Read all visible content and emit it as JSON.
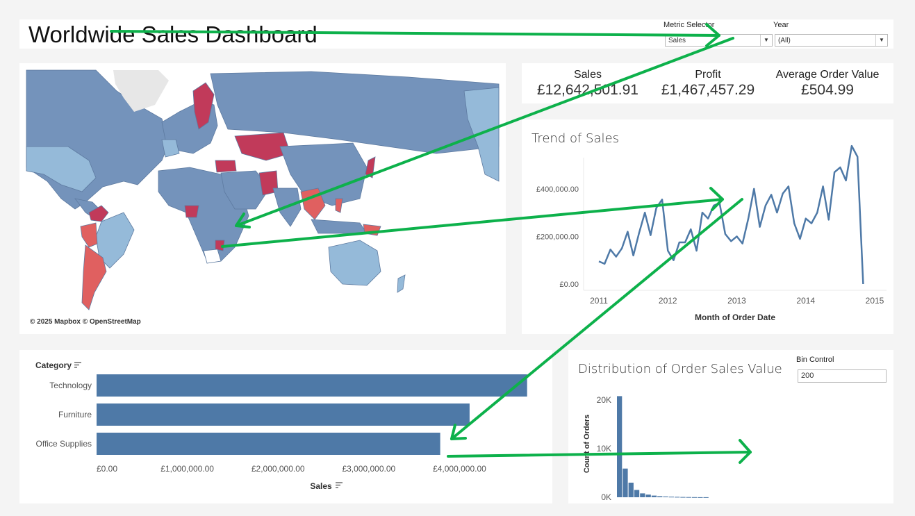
{
  "header": {
    "title": "Worldwide Sales Dashboard",
    "metric_selector": {
      "label": "Metric Selector",
      "value": "Sales"
    },
    "year": {
      "label": "Year",
      "value": "(All)"
    }
  },
  "map": {
    "credit": "© 2025 Mapbox © OpenStreetMap",
    "colors": {
      "ocean": "#ffffff",
      "land_base": "#7493bb",
      "land_light": "#95bad9",
      "land_low": "#c13a5a",
      "land_mid": "#e06060"
    }
  },
  "kpis": [
    {
      "label": "Sales",
      "value": "£12,642,501.91"
    },
    {
      "label": "Profit",
      "value": "£1,467,457.29"
    },
    {
      "label": "Average Order Value",
      "value": "£504.99"
    }
  ],
  "trend": {
    "title": "Trend of Sales",
    "xlabel": "Month of Order Date",
    "ytick_labels": [
      "£400,000.00",
      "£200,000.00",
      "£0.00"
    ],
    "xtick_labels": [
      "2011",
      "2012",
      "2013",
      "2014",
      "2015"
    ]
  },
  "category": {
    "header": "Category",
    "xlabel": "Sales",
    "xtick_labels": [
      "£0.00",
      "£1,000,000.00",
      "£2,000,000.00",
      "£3,000,000.00",
      "£4,000,000.00"
    ]
  },
  "distribution": {
    "title": "Distribution of Order Sales Value",
    "bin_control_label": "Bin Control",
    "bin_value": "200",
    "ylabel": "Count of Orders",
    "ytick_labels": [
      "20K",
      "10K",
      "0K"
    ]
  },
  "chart_data": [
    {
      "type": "line",
      "title": "Trend of Sales",
      "xlabel": "Month of Order Date",
      "ylabel": "",
      "xlim": [
        2011,
        2015
      ],
      "ylim": [
        0,
        560000
      ],
      "x": [
        2011.0,
        2011.083,
        2011.167,
        2011.25,
        2011.333,
        2011.417,
        2011.5,
        2011.583,
        2011.667,
        2011.75,
        2011.833,
        2011.917,
        2012.0,
        2012.083,
        2012.167,
        2012.25,
        2012.333,
        2012.417,
        2012.5,
        2012.583,
        2012.667,
        2012.75,
        2012.833,
        2012.917,
        2013.0,
        2013.083,
        2013.167,
        2013.25,
        2013.333,
        2013.417,
        2013.5,
        2013.583,
        2013.667,
        2013.75,
        2013.833,
        2013.917,
        2014.0,
        2014.083,
        2014.167,
        2014.25,
        2014.333,
        2014.417,
        2014.5,
        2014.583,
        2014.667,
        2014.75,
        2014.833,
        2014.917
      ],
      "series": [
        {
          "values": [
            95000,
            85000,
            145000,
            115000,
            150000,
            220000,
            120000,
            215000,
            300000,
            205000,
            320000,
            355000,
            140000,
            100000,
            175000,
            175000,
            230000,
            140000,
            300000,
            275000,
            330000,
            340000,
            210000,
            180000,
            200000,
            170000,
            275000,
            400000,
            240000,
            330000,
            375000,
            300000,
            380000,
            410000,
            255000,
            190000,
            275000,
            255000,
            300000,
            410000,
            270000,
            470000,
            490000,
            435000,
            580000,
            535000,
            0,
            0
          ]
        }
      ]
    },
    {
      "type": "bar",
      "orientation": "horizontal",
      "categories": [
        "Technology",
        "Furniture",
        "Office Supplies"
      ],
      "values": [
        4744691,
        4110874,
        3787070
      ],
      "xlabel": "Sales",
      "ylabel": "Category",
      "xlim": [
        0,
        4900000
      ]
    },
    {
      "type": "bar",
      "title": "Distribution of Order Sales Value",
      "ylabel": "Count of Orders",
      "ylim": [
        0,
        22000
      ],
      "values": [
        20800,
        5900,
        3000,
        1500,
        800,
        550,
        350,
        220,
        150,
        110,
        80,
        60,
        45,
        30,
        20,
        15
      ]
    }
  ]
}
